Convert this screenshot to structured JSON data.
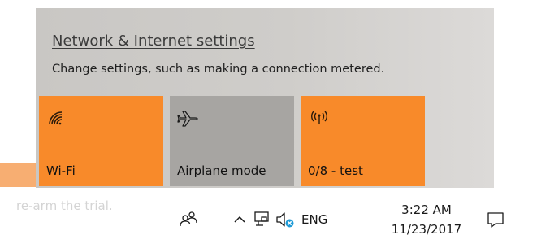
{
  "background": {
    "text": "re-arm the trial."
  },
  "panel": {
    "link": "Network & Internet settings",
    "description": "Change settings, such as making a connection metered."
  },
  "tiles": [
    {
      "label": "Wi-Fi",
      "icon": "wifi-icon",
      "state": "on"
    },
    {
      "label": "Airplane mode",
      "icon": "airplane-icon",
      "state": "off"
    },
    {
      "label": "0/8 - test",
      "icon": "mobile-hotspot-icon",
      "state": "on"
    }
  ],
  "taskbar": {
    "icons": [
      "people-icon",
      "chevron-up-icon",
      "network-icon",
      "volume-muted-icon",
      "action-center-icon"
    ],
    "language": "ENG",
    "time": "3:22 AM",
    "date": "11/23/2017"
  },
  "colors": {
    "tile_on": "#f88a2a",
    "tile_off": "#a7a5a2",
    "panel": "#cfcdca",
    "muted_badge": "#1e9ad6"
  }
}
